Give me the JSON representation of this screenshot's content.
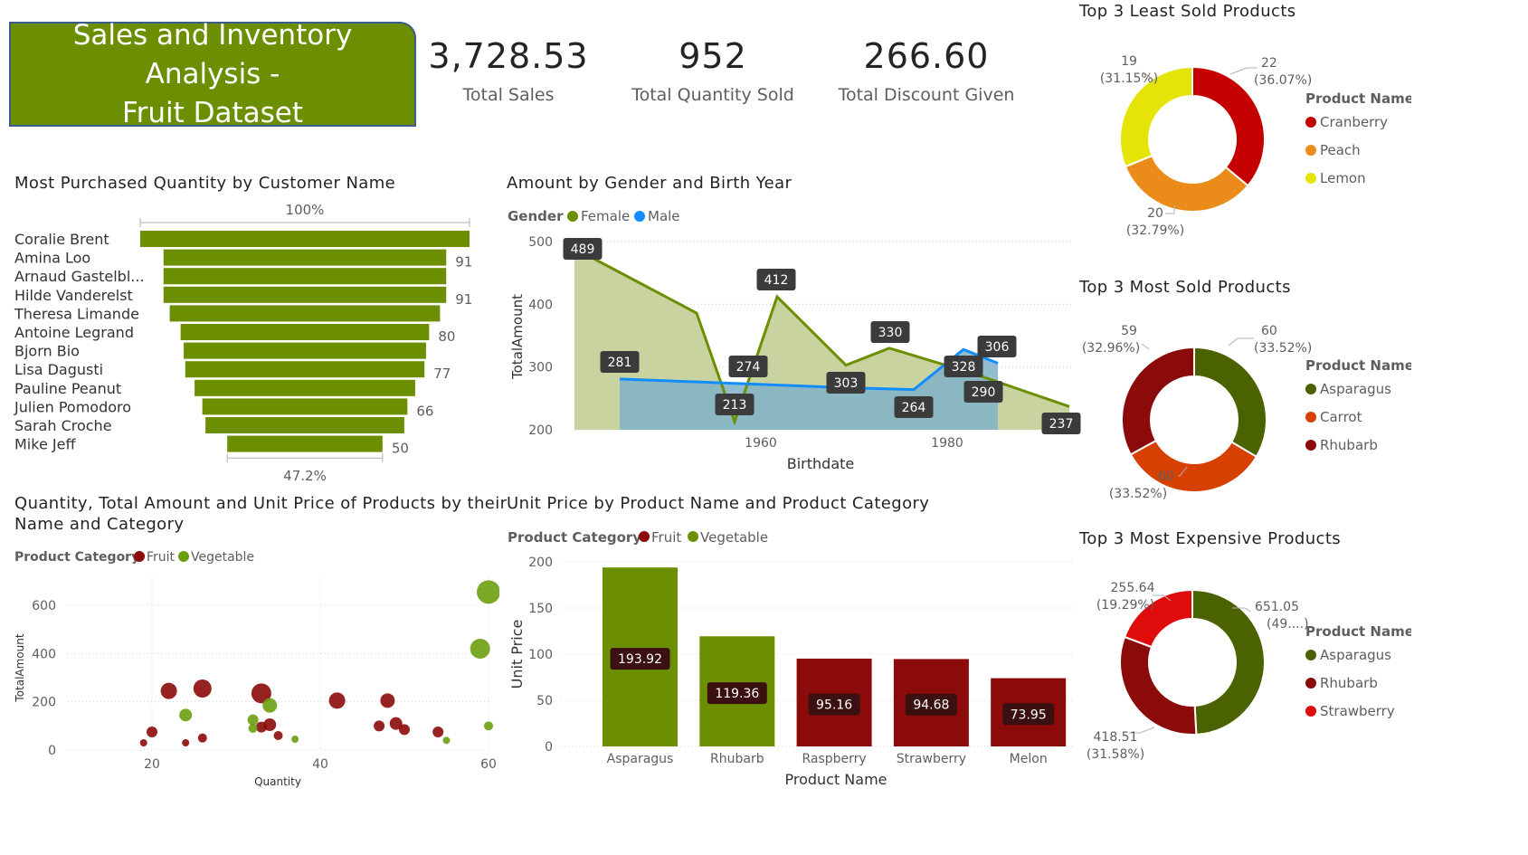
{
  "header": {
    "title_line1": "Sales and Inventory Analysis -",
    "title_line2": "Fruit Dataset"
  },
  "kpis": [
    {
      "value": "3,728.53",
      "label": "Total Sales"
    },
    {
      "value": "952",
      "label": "Total Quantity Sold"
    },
    {
      "value": "266.60",
      "label": "Total Discount Given"
    }
  ],
  "colors": {
    "green": "#6b8f00",
    "dark_red": "#8b0a0a",
    "blue": "#118dff",
    "female_fill": "#c6d19b",
    "male_fill": "#7fb2c8",
    "olive_dark": "#4a6200",
    "orange_red": "#d64000",
    "red": "#e00c0c",
    "orange": "#eb8c1a",
    "yellow": "#e4e406",
    "cranberry": "#c40000"
  },
  "chart_data": [
    {
      "id": "funnel",
      "type": "bar",
      "title": "Most Purchased Quantity by Customer Name",
      "top_label": "100%",
      "bottom_label": "47.2%",
      "categories": [
        "Coralie Brent",
        "Amina Loo",
        "Arnaud Gastelbl...",
        "Hilde Vanderelst",
        "Theresa Limande",
        "Antoine Legrand",
        "Bjorn Bio",
        "Lisa Dagusti",
        "Pauline Peanut",
        "Julien Pomodoro",
        "Sarah Croche",
        "Mike Jeff"
      ],
      "values": [
        106,
        91,
        91,
        91,
        87,
        80,
        78,
        77,
        71,
        66,
        64,
        50
      ],
      "data_labels": [
        "",
        "91",
        "",
        "91",
        "",
        "80",
        "",
        "77",
        "",
        "66",
        "",
        "50"
      ]
    },
    {
      "id": "area",
      "type": "area",
      "title": "Amount by Gender and Birth Year",
      "legend_title": "Gender",
      "xlabel": "Birthdate",
      "ylabel": "TotalAmount",
      "ylim": [
        200,
        500
      ],
      "xlim": [
        1940,
        1981
      ],
      "yticks": [
        "500",
        "400",
        "300",
        "200"
      ],
      "xticks": [
        "1960",
        "1980"
      ],
      "series": [
        {
          "name": "Female",
          "x": [
            1940,
            1953,
            1955,
            1964,
            1971,
            1974,
            1981,
            1995
          ],
          "y": [
            489,
            386,
            213,
            412,
            303,
            330,
            290,
            237
          ],
          "labels": [
            "489",
            "",
            "213",
            "412",
            "",
            "330",
            "290",
            "237"
          ]
        },
        {
          "name": "Male",
          "x": [
            1945,
            1957,
            1970,
            1977,
            1979,
            1981
          ],
          "y": [
            281,
            274,
            267,
            264,
            328,
            306
          ],
          "labels": [
            "281",
            "274",
            "303",
            "264",
            "328",
            "306"
          ]
        }
      ]
    },
    {
      "id": "scatter",
      "type": "scatter",
      "title_line1": "Quantity, Total Amount and Unit Price of Products by their",
      "title_line2": "Name and Category",
      "legend_title": "Product Category",
      "xlabel": "Quantity",
      "ylabel": "TotalAmount",
      "xlim": [
        15,
        60
      ],
      "ylim": [
        0,
        650
      ],
      "xticks": [
        "20",
        "40",
        "60"
      ],
      "yticks": [
        "600",
        "400",
        "200",
        "0"
      ],
      "series": [
        {
          "name": "Fruit",
          "points": [
            [
              19,
              30,
              4
            ],
            [
              20,
              75,
              6
            ],
            [
              22,
              245,
              9
            ],
            [
              24,
              30,
              4
            ],
            [
              26,
              255,
              10
            ],
            [
              26,
              50,
              5
            ],
            [
              33,
              235,
              11
            ],
            [
              34,
              105,
              7
            ],
            [
              33,
              95,
              6
            ],
            [
              35,
              60,
              5
            ],
            [
              42,
              205,
              9
            ],
            [
              48,
              205,
              8
            ],
            [
              49,
              110,
              7
            ],
            [
              50,
              85,
              6
            ],
            [
              47,
              100,
              6
            ],
            [
              54,
              75,
              6
            ]
          ]
        },
        {
          "name": "Vegetable",
          "points": [
            [
              24,
              145,
              7
            ],
            [
              32,
              125,
              6
            ],
            [
              34,
              185,
              8
            ],
            [
              32,
              90,
              5
            ],
            [
              37,
              45,
              4
            ],
            [
              55,
              40,
              4
            ],
            [
              59,
              420,
              11
            ],
            [
              60,
              655,
              13
            ],
            [
              60,
              100,
              5
            ]
          ]
        }
      ]
    },
    {
      "id": "bars",
      "type": "bar",
      "title": "Unit Price by Product Name and Product Category",
      "legend_title": "Product Category",
      "xlabel": "Product Name",
      "ylabel": "Unit Price",
      "ylim": [
        0,
        200
      ],
      "yticks": [
        "200",
        "150",
        "100",
        "50",
        "0"
      ],
      "legend": [
        "Fruit",
        "Vegetable"
      ],
      "categories": [
        "Asparagus",
        "Rhubarb",
        "Raspberry",
        "Strawberry",
        "Melon"
      ],
      "values": [
        193.92,
        119.36,
        95.16,
        94.68,
        73.95
      ],
      "value_labels": [
        "193.92",
        "119.36",
        "95.16",
        "94.68",
        "73.95"
      ],
      "category_of": [
        "Vegetable",
        "Vegetable",
        "Fruit",
        "Fruit",
        "Fruit"
      ]
    },
    {
      "id": "donut1",
      "type": "pie",
      "title": "Top 3 Least Sold Products",
      "legend_title": "Product Name",
      "labels": [
        "Cranberry",
        "Peach",
        "Lemon"
      ],
      "values": [
        22,
        20,
        19
      ],
      "value_labels": [
        "22",
        "20",
        "19"
      ],
      "pct_labels": [
        "(36.07%)",
        "(32.79%)",
        "(31.15%)"
      ]
    },
    {
      "id": "donut2",
      "type": "pie",
      "title": "Top 3 Most Sold Products",
      "legend_title": "Product Name",
      "labels": [
        "Asparagus",
        "Carrot",
        "Rhubarb"
      ],
      "values": [
        60,
        60,
        59
      ],
      "value_labels": [
        "60",
        "60",
        "59"
      ],
      "pct_labels": [
        "(33.52%)",
        "(33.52%)",
        "(32.96%)"
      ]
    },
    {
      "id": "donut3",
      "type": "pie",
      "title": "Top 3 Most Expensive Products",
      "legend_title": "Product Name",
      "labels": [
        "Asparagus",
        "Rhubarb",
        "Strawberry"
      ],
      "values": [
        651.05,
        418.51,
        255.64
      ],
      "value_labels": [
        "651.05",
        "418.51",
        "255.64"
      ],
      "pct_labels": [
        "(49....)",
        "(31.58%)",
        "(19.29%)"
      ]
    }
  ]
}
